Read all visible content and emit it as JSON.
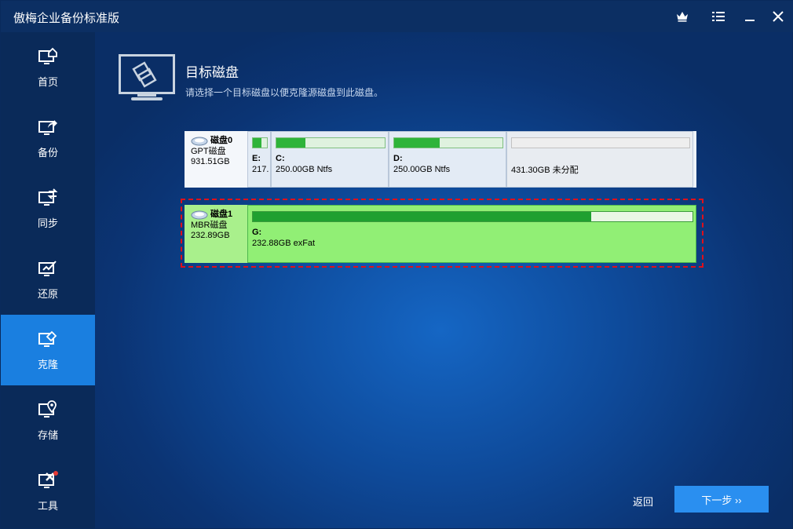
{
  "window": {
    "title": "傲梅企业备份标准版"
  },
  "titlebar": {
    "icons": [
      "crown-icon",
      "menu-icon",
      "minimize-icon",
      "close-icon"
    ]
  },
  "sidebar": {
    "items": [
      {
        "label": "首页",
        "icon": "home-icon"
      },
      {
        "label": "备份",
        "icon": "backup-icon"
      },
      {
        "label": "同步",
        "icon": "sync-icon"
      },
      {
        "label": "还原",
        "icon": "restore-icon"
      },
      {
        "label": "克隆",
        "icon": "clone-icon",
        "active": true
      },
      {
        "label": "存储",
        "icon": "storage-icon"
      },
      {
        "label": "工具",
        "icon": "tools-icon",
        "badge": true
      }
    ]
  },
  "header": {
    "title": "目标磁盘",
    "subtitle": "请选择一个目标磁盘以便克隆源磁盘到此磁盘。"
  },
  "disks": [
    {
      "name": "磁盘0",
      "type": "GPT磁盘",
      "size": "931.51GB",
      "partitions": [
        {
          "label": "E:",
          "desc": "217.",
          "used": 0.6
        },
        {
          "label": "C:",
          "desc": "250.00GB Ntfs",
          "used": 0.27
        },
        {
          "label": "D:",
          "desc": "250.00GB Ntfs",
          "used": 0.42
        },
        {
          "label": "",
          "desc": "431.30GB 未分配",
          "used": 0
        }
      ]
    },
    {
      "name": "磁盘1",
      "type": "MBR磁盘",
      "size": "232.89GB",
      "selected": true,
      "partitions": [
        {
          "label": "G:",
          "desc": "232.88GB exFat",
          "used": 0.77
        }
      ]
    }
  ],
  "footer": {
    "back_label": "返回",
    "next_label": "下一步 ››"
  },
  "colors": {
    "accent": "#1a7fe0",
    "selected_disk": "#91ef75",
    "selection_border": "#e0101a",
    "used_bar": "#2eb43a"
  }
}
